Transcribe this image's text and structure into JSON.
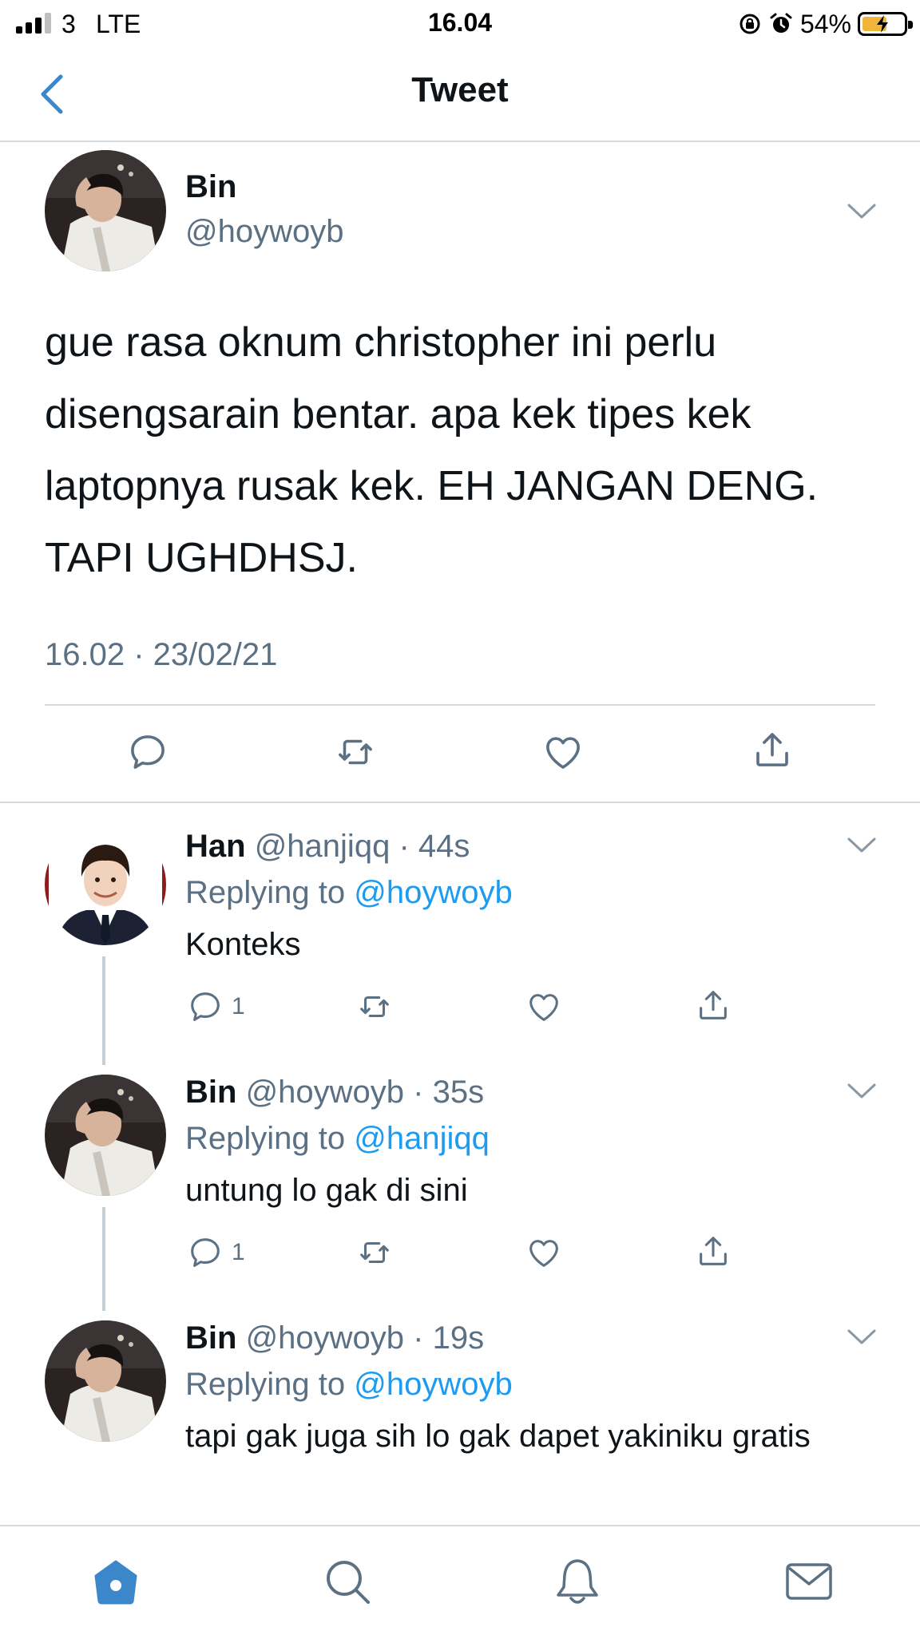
{
  "status_bar": {
    "signal_bars": 3,
    "carrier": "3",
    "network": "LTE",
    "time": "16.04",
    "battery": "54%",
    "icons": [
      "signal-icon",
      "orientation-lock-icon",
      "alarm-icon",
      "battery-charging-icon"
    ]
  },
  "nav": {
    "title": "Tweet",
    "back_icon": "chevron-left-icon"
  },
  "main_tweet": {
    "name": "Bin",
    "handle": "@hoywoyb",
    "text": "gue rasa oknum christopher ini perlu disengsarain bentar. apa kek tipes kek laptopnya rusak kek. EH JANGAN DENG. TAPI UGHDHSJ.",
    "timestamp": "16.02 · 23/02/21",
    "actions": [
      "reply-icon",
      "retweet-icon",
      "like-icon",
      "share-icon"
    ]
  },
  "replies": [
    {
      "name": "Han",
      "handle": "@hanjiqq",
      "age": "· 44s",
      "replying_prefix": "Replying to ",
      "replying_to": "@hoywoyb",
      "text": "Konteks",
      "reply_count": "1"
    },
    {
      "name": "Bin",
      "handle": "@hoywoyb",
      "age": "· 35s",
      "replying_prefix": "Replying to ",
      "replying_to": "@hanjiqq",
      "text": "untung lo gak di sini",
      "reply_count": "1"
    },
    {
      "name": "Bin",
      "handle": "@hoywoyb",
      "age": "· 19s",
      "replying_prefix": "Replying to ",
      "replying_to": "@hoywoyb",
      "text": "tapi gak juga sih lo gak dapet yakiniku gratis"
    }
  ],
  "tab_bar": {
    "items": [
      "home-icon",
      "search-icon",
      "notifications-icon",
      "messages-icon"
    ],
    "active": "home-icon"
  },
  "colors": {
    "accent": "#1d9bf0",
    "text_primary": "#0f1419",
    "text_secondary": "#5b7083",
    "divider": "#d4dadf",
    "battery": "#f0b53a"
  }
}
